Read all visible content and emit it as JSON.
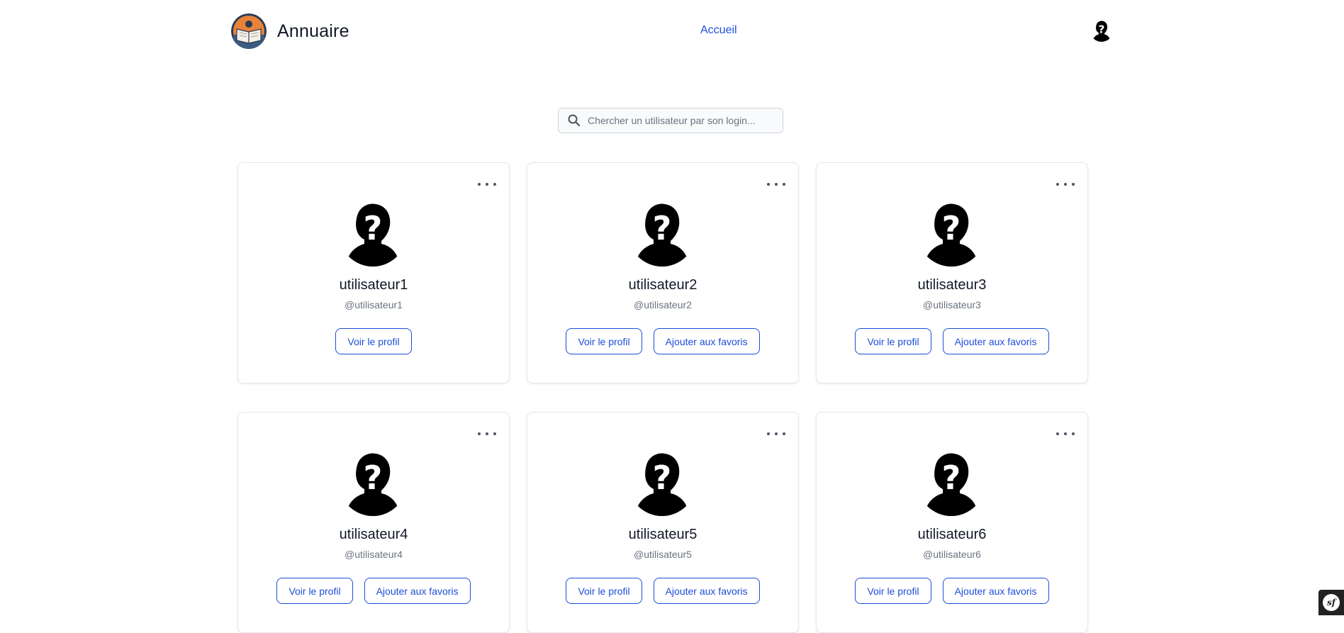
{
  "header": {
    "brand_title": "Annuaire",
    "nav": [
      {
        "label": "Accueil"
      }
    ],
    "logo_icon": "book-reading-icon",
    "user_avatar_icon": "unknown-user-avatar-icon"
  },
  "search": {
    "placeholder": "Chercher un utilisateur par son login...",
    "value": "",
    "icon": "search-icon"
  },
  "users": [
    {
      "name": "utilisateur1",
      "login": "@utilisateur1",
      "view_label": "Voir le profil"
    },
    {
      "name": "utilisateur2",
      "login": "@utilisateur2",
      "view_label": "Voir le profil",
      "fav_label": "Ajouter aux favoris"
    },
    {
      "name": "utilisateur3",
      "login": "@utilisateur3",
      "view_label": "Voir le profil",
      "fav_label": "Ajouter aux favoris"
    },
    {
      "name": "utilisateur4",
      "login": "@utilisateur4",
      "view_label": "Voir le profil",
      "fav_label": "Ajouter aux favoris"
    },
    {
      "name": "utilisateur5",
      "login": "@utilisateur5",
      "view_label": "Voir le profil",
      "fav_label": "Ajouter aux favoris"
    },
    {
      "name": "utilisateur6",
      "login": "@utilisateur6",
      "view_label": "Voir le profil",
      "fav_label": "Ajouter aux favoris"
    }
  ],
  "colors": {
    "accent": "#1d4ed8",
    "text": "#111827",
    "muted": "#6b7280",
    "border": "#e5e7eb"
  },
  "debug_toolbar": {
    "icon": "symfony-icon"
  }
}
